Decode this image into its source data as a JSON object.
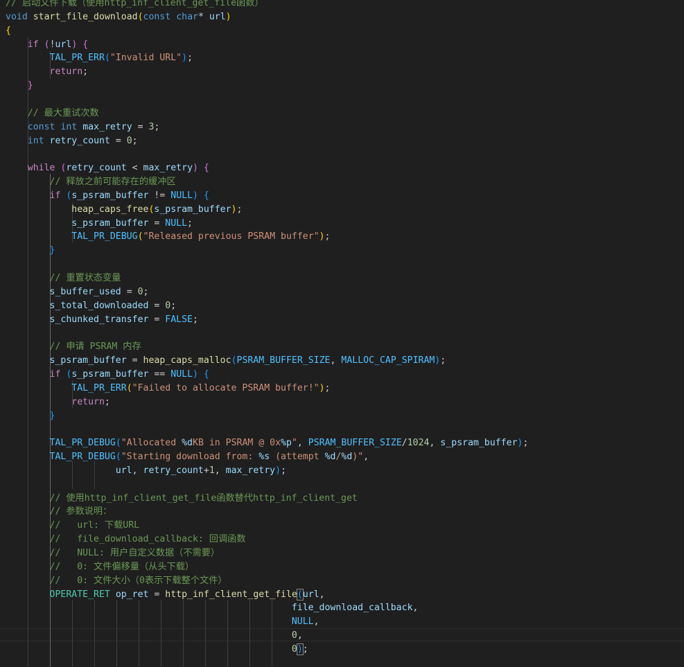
{
  "colors": {
    "comment": "#6a9955",
    "keyword": "#569cd6",
    "control": "#c586c0",
    "function": "#dcdcaa",
    "variable": "#9cdcfe",
    "macro": "#4fc1ff",
    "string": "#ce9178",
    "number": "#b5cea8",
    "type": "#4ec9b0",
    "default": "#cccccc",
    "bracket_level_1": "#ffd700",
    "bracket_level_2": "#da70d6",
    "bracket_level_3": "#179fff",
    "background": "#1f1f1f"
  },
  "editor": {
    "lines": [
      [
        [
          "comment",
          "// 启动文件下载（使用http_inf_client_get_file函数）"
        ]
      ],
      [
        [
          "keyword",
          "void"
        ],
        [
          "punct",
          " "
        ],
        [
          "func",
          "start_file_download"
        ],
        [
          "b1",
          "("
        ],
        [
          "keyword",
          "const"
        ],
        [
          "punct",
          " "
        ],
        [
          "keyword",
          "char"
        ],
        [
          "punct",
          "* "
        ],
        [
          "var",
          "url"
        ],
        [
          "b1",
          ")"
        ]
      ],
      [
        [
          "b1",
          "{"
        ]
      ],
      [
        [
          "punct",
          "    "
        ],
        [
          "control",
          "if"
        ],
        [
          "punct",
          " "
        ],
        [
          "b2",
          "("
        ],
        [
          "punct",
          "!"
        ],
        [
          "var",
          "url"
        ],
        [
          "b2",
          ")"
        ],
        [
          "punct",
          " "
        ],
        [
          "b2",
          "{"
        ]
      ],
      [
        [
          "punct",
          "        "
        ],
        [
          "macro",
          "TAL_PR_ERR"
        ],
        [
          "b3",
          "("
        ],
        [
          "string",
          "\"Invalid URL\""
        ],
        [
          "b3",
          ")"
        ],
        [
          "punct",
          ";"
        ]
      ],
      [
        [
          "punct",
          "        "
        ],
        [
          "control",
          "return"
        ],
        [
          "punct",
          ";"
        ]
      ],
      [
        [
          "punct",
          "    "
        ],
        [
          "b2",
          "}"
        ]
      ],
      [],
      [
        [
          "punct",
          "    "
        ],
        [
          "comment",
          "// 最大重试次数"
        ]
      ],
      [
        [
          "punct",
          "    "
        ],
        [
          "keyword",
          "const"
        ],
        [
          "punct",
          " "
        ],
        [
          "keyword",
          "int"
        ],
        [
          "punct",
          " "
        ],
        [
          "var",
          "max_retry"
        ],
        [
          "punct",
          " = "
        ],
        [
          "number",
          "3"
        ],
        [
          "punct",
          ";"
        ]
      ],
      [
        [
          "punct",
          "    "
        ],
        [
          "keyword",
          "int"
        ],
        [
          "punct",
          " "
        ],
        [
          "var",
          "retry_count"
        ],
        [
          "punct",
          " = "
        ],
        [
          "number",
          "0"
        ],
        [
          "punct",
          ";"
        ]
      ],
      [],
      [
        [
          "punct",
          "    "
        ],
        [
          "control",
          "while"
        ],
        [
          "punct",
          " "
        ],
        [
          "b2",
          "("
        ],
        [
          "var",
          "retry_count"
        ],
        [
          "punct",
          " < "
        ],
        [
          "var",
          "max_retry"
        ],
        [
          "b2",
          ")"
        ],
        [
          "punct",
          " "
        ],
        [
          "b2",
          "{"
        ]
      ],
      [
        [
          "punct",
          "        "
        ],
        [
          "comment",
          "// 释放之前可能存在的缓冲区"
        ]
      ],
      [
        [
          "punct",
          "        "
        ],
        [
          "control",
          "if"
        ],
        [
          "punct",
          " "
        ],
        [
          "b3",
          "("
        ],
        [
          "var",
          "s_psram_buffer"
        ],
        [
          "punct",
          " != "
        ],
        [
          "macro",
          "NULL"
        ],
        [
          "b3",
          ")"
        ],
        [
          "punct",
          " "
        ],
        [
          "b3",
          "{"
        ]
      ],
      [
        [
          "punct",
          "            "
        ],
        [
          "func",
          "heap_caps_free"
        ],
        [
          "b1",
          "("
        ],
        [
          "var",
          "s_psram_buffer"
        ],
        [
          "b1",
          ")"
        ],
        [
          "punct",
          ";"
        ]
      ],
      [
        [
          "punct",
          "            "
        ],
        [
          "var",
          "s_psram_buffer"
        ],
        [
          "punct",
          " = "
        ],
        [
          "macro",
          "NULL"
        ],
        [
          "punct",
          ";"
        ]
      ],
      [
        [
          "punct",
          "            "
        ],
        [
          "macro",
          "TAL_PR_DEBUG"
        ],
        [
          "b1",
          "("
        ],
        [
          "string",
          "\"Released previous PSRAM buffer\""
        ],
        [
          "b1",
          ")"
        ],
        [
          "punct",
          ";"
        ]
      ],
      [
        [
          "punct",
          "        "
        ],
        [
          "b3",
          "}"
        ]
      ],
      [],
      [
        [
          "punct",
          "        "
        ],
        [
          "comment",
          "// 重置状态变量"
        ]
      ],
      [
        [
          "punct",
          "        "
        ],
        [
          "var",
          "s_buffer_used"
        ],
        [
          "punct",
          " = "
        ],
        [
          "number",
          "0"
        ],
        [
          "punct",
          ";"
        ]
      ],
      [
        [
          "punct",
          "        "
        ],
        [
          "var",
          "s_total_downloaded"
        ],
        [
          "punct",
          " = "
        ],
        [
          "number",
          "0"
        ],
        [
          "punct",
          ";"
        ]
      ],
      [
        [
          "punct",
          "        "
        ],
        [
          "var",
          "s_chunked_transfer"
        ],
        [
          "punct",
          " = "
        ],
        [
          "macro",
          "FALSE"
        ],
        [
          "punct",
          ";"
        ]
      ],
      [],
      [
        [
          "punct",
          "        "
        ],
        [
          "comment",
          "// 申请 PSRAM 内存"
        ]
      ],
      [
        [
          "punct",
          "        "
        ],
        [
          "var",
          "s_psram_buffer"
        ],
        [
          "punct",
          " = "
        ],
        [
          "func",
          "heap_caps_malloc"
        ],
        [
          "b3",
          "("
        ],
        [
          "macro",
          "PSRAM_BUFFER_SIZE"
        ],
        [
          "punct",
          ", "
        ],
        [
          "macro",
          "MALLOC_CAP_SPIRAM"
        ],
        [
          "b3",
          ")"
        ],
        [
          "punct",
          ";"
        ]
      ],
      [
        [
          "punct",
          "        "
        ],
        [
          "control",
          "if"
        ],
        [
          "punct",
          " "
        ],
        [
          "b3",
          "("
        ],
        [
          "var",
          "s_psram_buffer"
        ],
        [
          "punct",
          " == "
        ],
        [
          "macro",
          "NULL"
        ],
        [
          "b3",
          ")"
        ],
        [
          "punct",
          " "
        ],
        [
          "b3",
          "{"
        ]
      ],
      [
        [
          "punct",
          "            "
        ],
        [
          "macro",
          "TAL_PR_ERR"
        ],
        [
          "b1",
          "("
        ],
        [
          "string",
          "\"Failed to allocate PSRAM buffer!\""
        ],
        [
          "b1",
          ")"
        ],
        [
          "punct",
          ";"
        ]
      ],
      [
        [
          "punct",
          "            "
        ],
        [
          "control",
          "return"
        ],
        [
          "punct",
          ";"
        ]
      ],
      [
        [
          "punct",
          "        "
        ],
        [
          "b3",
          "}"
        ]
      ],
      [],
      [
        [
          "punct",
          "        "
        ],
        [
          "macro",
          "TAL_PR_DEBUG"
        ],
        [
          "b3",
          "("
        ],
        [
          "string",
          "\"Allocated "
        ],
        [
          "fmt",
          "%d"
        ],
        [
          "string",
          "KB in PSRAM @ 0x"
        ],
        [
          "fmt",
          "%p"
        ],
        [
          "string",
          "\""
        ],
        [
          "punct",
          ", "
        ],
        [
          "macro",
          "PSRAM_BUFFER_SIZE"
        ],
        [
          "punct",
          "/"
        ],
        [
          "number",
          "1024"
        ],
        [
          "punct",
          ", "
        ],
        [
          "var",
          "s_psram_buffer"
        ],
        [
          "b3",
          ")"
        ],
        [
          "punct",
          ";"
        ]
      ],
      [
        [
          "punct",
          "        "
        ],
        [
          "macro",
          "TAL_PR_DEBUG"
        ],
        [
          "b3",
          "("
        ],
        [
          "string",
          "\"Starting download from: "
        ],
        [
          "fmt",
          "%s"
        ],
        [
          "string",
          " (attempt "
        ],
        [
          "fmt",
          "%d"
        ],
        [
          "string",
          "/"
        ],
        [
          "fmt",
          "%d"
        ],
        [
          "string",
          ")\""
        ],
        [
          "punct",
          ","
        ]
      ],
      [
        [
          "punct",
          "                    "
        ],
        [
          "var",
          "url"
        ],
        [
          "punct",
          ", "
        ],
        [
          "var",
          "retry_count"
        ],
        [
          "punct",
          "+"
        ],
        [
          "number",
          "1"
        ],
        [
          "punct",
          ", "
        ],
        [
          "var",
          "max_retry"
        ],
        [
          "b3",
          ")"
        ],
        [
          "punct",
          ";"
        ]
      ],
      [],
      [
        [
          "punct",
          "        "
        ],
        [
          "comment",
          "// 使用http_inf_client_get_file函数替代http_inf_client_get"
        ]
      ],
      [
        [
          "punct",
          "        "
        ],
        [
          "comment",
          "// 参数说明："
        ]
      ],
      [
        [
          "punct",
          "        "
        ],
        [
          "comment",
          "//   url: 下载URL"
        ]
      ],
      [
        [
          "punct",
          "        "
        ],
        [
          "comment",
          "//   file_download_callback: 回调函数"
        ]
      ],
      [
        [
          "punct",
          "        "
        ],
        [
          "comment",
          "//   NULL: 用户自定义数据（不需要）"
        ]
      ],
      [
        [
          "punct",
          "        "
        ],
        [
          "comment",
          "//   0: 文件偏移量（从头下载）"
        ]
      ],
      [
        [
          "punct",
          "        "
        ],
        [
          "comment",
          "//   0: 文件大小（0表示下载整个文件）"
        ]
      ],
      [
        [
          "punct",
          "        "
        ],
        [
          "type",
          "OPERATE_RET"
        ],
        [
          "punct",
          " "
        ],
        [
          "var",
          "op_ret"
        ],
        [
          "punct",
          " = "
        ],
        [
          "func",
          "http_inf_client_get_file"
        ],
        [
          "b3",
          "("
        ],
        [
          "var",
          "url"
        ],
        [
          "punct",
          ","
        ]
      ],
      [
        [
          "punct",
          "                                                    "
        ],
        [
          "var",
          "file_download_callback"
        ],
        [
          "punct",
          ","
        ]
      ],
      [
        [
          "punct",
          "                                                    "
        ],
        [
          "macro",
          "NULL"
        ],
        [
          "punct",
          ","
        ]
      ],
      [
        [
          "punct",
          "                                                    "
        ],
        [
          "number",
          "0"
        ],
        [
          "punct",
          ","
        ]
      ],
      [
        [
          "punct",
          "                                                    "
        ],
        [
          "number",
          "0"
        ],
        [
          "b3",
          ")"
        ],
        [
          "punct",
          ";"
        ]
      ]
    ]
  }
}
